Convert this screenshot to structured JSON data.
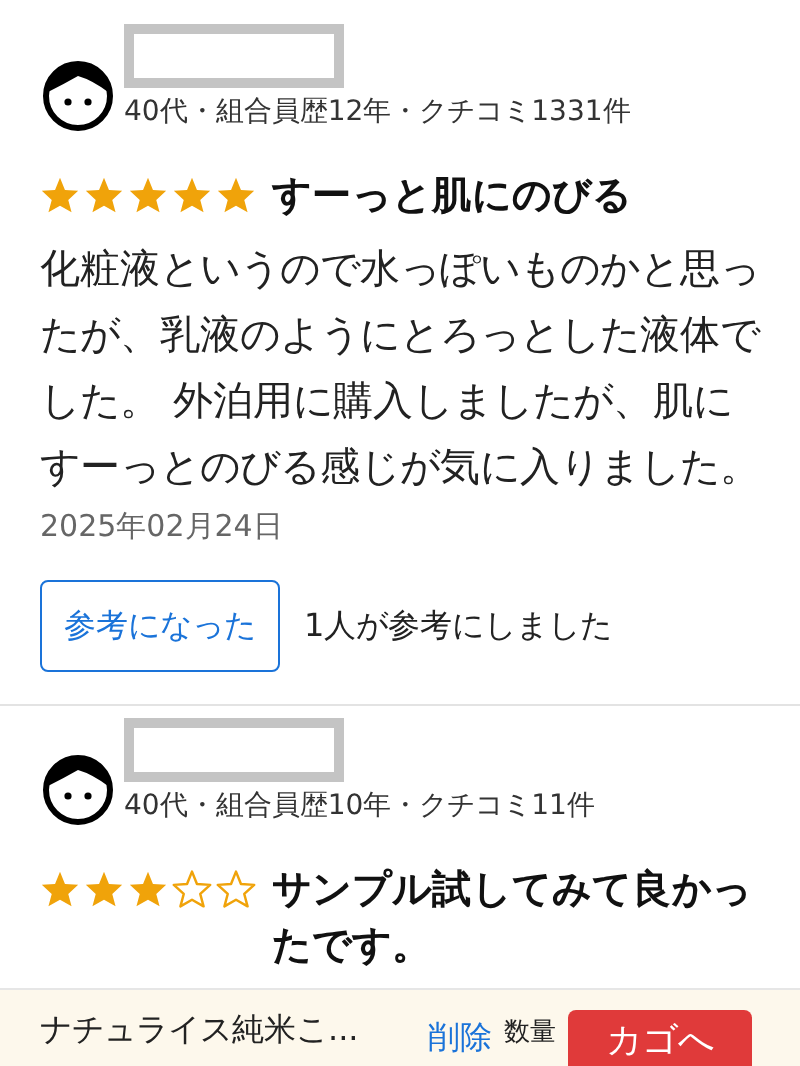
{
  "reviews": [
    {
      "meta": "40代・組合員歴12年・クチコミ1331件",
      "stars": 5,
      "title": "すーっと肌にのびる",
      "body": "化粧液というので水っぽいものかと思ったが、乳液のようにとろっとした液体でした。 外泊用に購入しましたが、肌にすーっとのびる感じが気に入りました。",
      "date": "2025年02月24日",
      "helpful_button": "参考になった",
      "helpful_count": "1人が参考にしました"
    },
    {
      "meta": "40代・組合員歴10年・クチコミ11件",
      "stars": 3,
      "title": "サンプル試してみて良かったです。"
    }
  ],
  "cart_bar": {
    "product": "ナチュライス純米こ...",
    "remove": "削除",
    "quantity_label": "数量",
    "add_button": "カゴへ"
  }
}
